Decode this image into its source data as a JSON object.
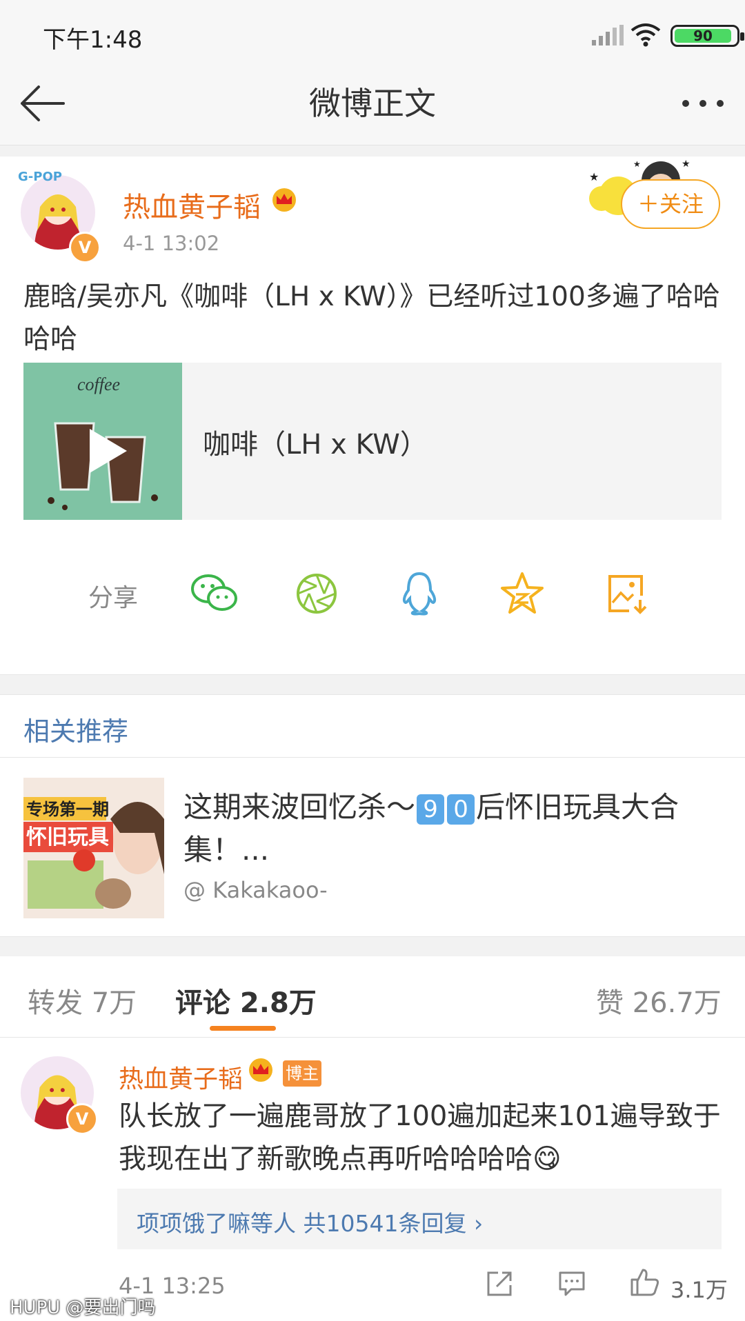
{
  "status_bar": {
    "time": "下午1:48",
    "battery": "90"
  },
  "nav": {
    "title": "微博正文"
  },
  "post": {
    "author": "热血黄子韬",
    "time": "4-1 13:02",
    "follow_label": "＋关注",
    "text": "鹿晗/吴亦凡《咖啡（LH x KW）》已经听过100多遍了哈哈哈哈",
    "music": {
      "title": "咖啡（LH x KW）",
      "cover_text": "coffee"
    }
  },
  "share": {
    "label": "分享",
    "icons": [
      "wechat-icon",
      "moments-icon",
      "qq-icon",
      "qzone-icon",
      "save-image-icon"
    ]
  },
  "related": {
    "title": "相关推荐",
    "item": {
      "text_before": "这期来波回忆杀～",
      "digits": [
        "9",
        "0"
      ],
      "text_after": "后怀旧玩具大合集！...",
      "author": "@ Kakakaoo-",
      "thumb_title": "怀旧玩具",
      "thumb_subtitle": "专场第一期"
    }
  },
  "tabs": {
    "repost": "转发 7万",
    "comment": "评论 2.8万",
    "like": "赞 26.7万"
  },
  "comment": {
    "author": "热血黄子韬",
    "tag": "博主",
    "text": "队长放了一遍鹿哥放了100遍加起来101遍导致于我现在出了新歌晚点再听哈哈哈哈😋",
    "replies": "项项饿了嘛等人  共10541条回复 ›",
    "time": "4-1 13:25",
    "likes": "3.1万"
  },
  "watermark": "HUPU @要出门吗",
  "colors": {
    "accent": "#e86c1b",
    "link": "#4d7ab0",
    "follow": "#f5a623"
  }
}
